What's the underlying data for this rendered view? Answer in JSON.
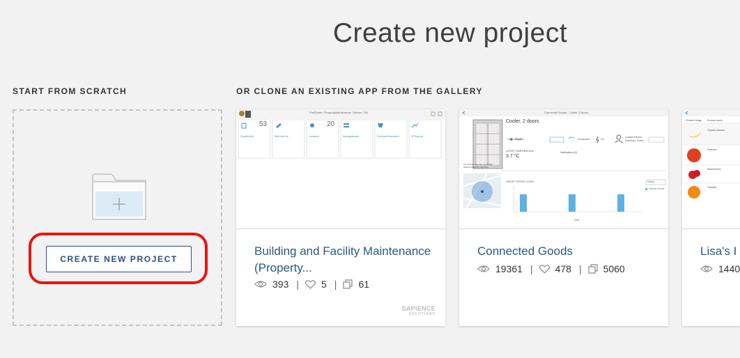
{
  "page": {
    "title": "Create new project"
  },
  "sections": {
    "scratch_label": "START FROM SCRATCH",
    "gallery_label": "OR CLONE AN EXISTING APP FROM THE GALLERY"
  },
  "scratch": {
    "button_label": "CREATE NEW PROJECT",
    "highlight_color": "#e8150f"
  },
  "gallery": {
    "cards": [
      {
        "title": "Building and Facility Maintenance (Property...",
        "views": "393",
        "likes": "5",
        "clones": "61",
        "vendor": "SAPIENCE",
        "vendor_sub": "SOLUTIONS",
        "thumb": {
          "header": "FeeExpert / PropertyMaintenance / Manos / Ok",
          "tiles": [
            {
              "count": "53",
              "label": "QuestionSet"
            },
            {
              "count": "",
              "label": "SetOrderList"
            },
            {
              "count": "20",
              "label": "Locations"
            },
            {
              "count": "",
              "label": "ManageAssets"
            },
            {
              "count": "",
              "label": "PurchaseRequisition"
            },
            {
              "count": "",
              "label": "SPReports"
            }
          ]
        }
      },
      {
        "title": "Connected Goods",
        "views": "19361",
        "likes": "478",
        "clones": "5060",
        "thumb": {
          "header": "Connected Goods - Cooler, 2 doors",
          "product": "Cooler, 2 doors",
          "device_id": "1401-143-DE",
          "status": "Mapped",
          "connectivity": "Connected",
          "power": "On",
          "contact_label": "Contact Person",
          "contact_name": "Friedman, Yoram",
          "temp_label": "LATEST TEMPERATURE",
          "temp_value": "3.7 °C",
          "notifications_label": "Notifications (5)",
          "chart_label": "ON/OFF STATUS COUNT",
          "chart_period": "Hourly",
          "chart_legend": "ON/OFF COUNT",
          "address": "Ltd. Ruessenber Str. 13, 60150 Waldorf Walldorf, Germany",
          "x_axis": "Hour"
        }
      },
      {
        "title": "Lisa's I",
        "views": "1440",
        "thumb": {
          "col1": "Product Image",
          "col2": "Product name",
          "rows": [
            "Organic banana",
            "Peaches",
            "Strawberries",
            "Oranges"
          ]
        }
      }
    ]
  },
  "colors": {
    "accent": "#2a4f86",
    "title_link": "#2a5a7c",
    "bar": "#5db1e4"
  }
}
